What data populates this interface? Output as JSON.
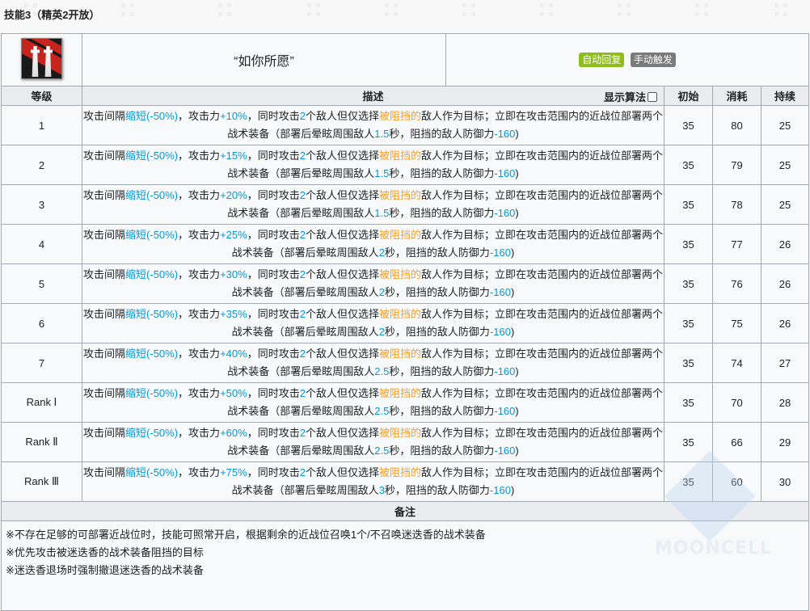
{
  "section_title": "技能3（精英2开放）",
  "skill": {
    "name": "“如你所愿”",
    "icon": "skill-icon-twin-towers",
    "tags": [
      {
        "label": "自动回复",
        "color": "#8ebd1c"
      },
      {
        "label": "手动触发",
        "color": "#7a7a7a"
      }
    ]
  },
  "table_headers": {
    "level": "等级",
    "description": "描述",
    "show_formula": "显示算法",
    "initial": "初始",
    "cost": "消耗",
    "duration": "持续"
  },
  "desc_template": {
    "p1": "攻击间隔",
    "shorten": "缩短(-50%)",
    "p2": "，攻击力",
    "p3": "，同时攻击",
    "targets": "2",
    "p4": "个敌人但仅选择",
    "blocked": "被阻挡的",
    "p5": "敌人作为目标；立即在攻击范围内的近战位部署两个战术装备（部署后晕眩周围敌人",
    "p6": "秒，阻挡的敌人防御力",
    "def": "-160",
    "p7": ")"
  },
  "rows": [
    {
      "level": "1",
      "atk": "+10%",
      "stun": "1.5",
      "initial": "35",
      "cost": "80",
      "duration": "25"
    },
    {
      "level": "2",
      "atk": "+15%",
      "stun": "1.5",
      "initial": "35",
      "cost": "79",
      "duration": "25"
    },
    {
      "level": "3",
      "atk": "+20%",
      "stun": "1.5",
      "initial": "35",
      "cost": "78",
      "duration": "25"
    },
    {
      "level": "4",
      "atk": "+25%",
      "stun": "2",
      "initial": "35",
      "cost": "77",
      "duration": "26"
    },
    {
      "level": "5",
      "atk": "+30%",
      "stun": "2",
      "initial": "35",
      "cost": "76",
      "duration": "26"
    },
    {
      "level": "6",
      "atk": "+35%",
      "stun": "2",
      "initial": "35",
      "cost": "75",
      "duration": "26"
    },
    {
      "level": "7",
      "atk": "+40%",
      "stun": "2.5",
      "initial": "35",
      "cost": "74",
      "duration": "27"
    },
    {
      "level": "Rank Ⅰ",
      "atk": "+50%",
      "stun": "2.5",
      "initial": "35",
      "cost": "70",
      "duration": "28"
    },
    {
      "level": "Rank Ⅱ",
      "atk": "+60%",
      "stun": "2.5",
      "initial": "35",
      "cost": "66",
      "duration": "29"
    },
    {
      "level": "Rank Ⅲ",
      "atk": "+75%",
      "stun": "3",
      "initial": "35",
      "cost": "60",
      "duration": "30"
    }
  ],
  "notes_header": "备注",
  "notes": [
    "※不存在足够的可部署近战位时，技能可照常开启，根据剩余的近战位召唤1个/不召唤迷迭香的战术装备",
    "※优先攻击被迷迭香的战术装备阻挡的目标",
    "※迷迭香退场时强制撤退迷迭香的战术装备"
  ],
  "watermark": "MOONCELL",
  "colors": {
    "highlight_blue": "#0098dc",
    "highlight_orange": "#ff9c1b",
    "header_bg": "#eaecf0",
    "cell_bg": "#f8f9fa",
    "border": "#a2a9b1"
  }
}
